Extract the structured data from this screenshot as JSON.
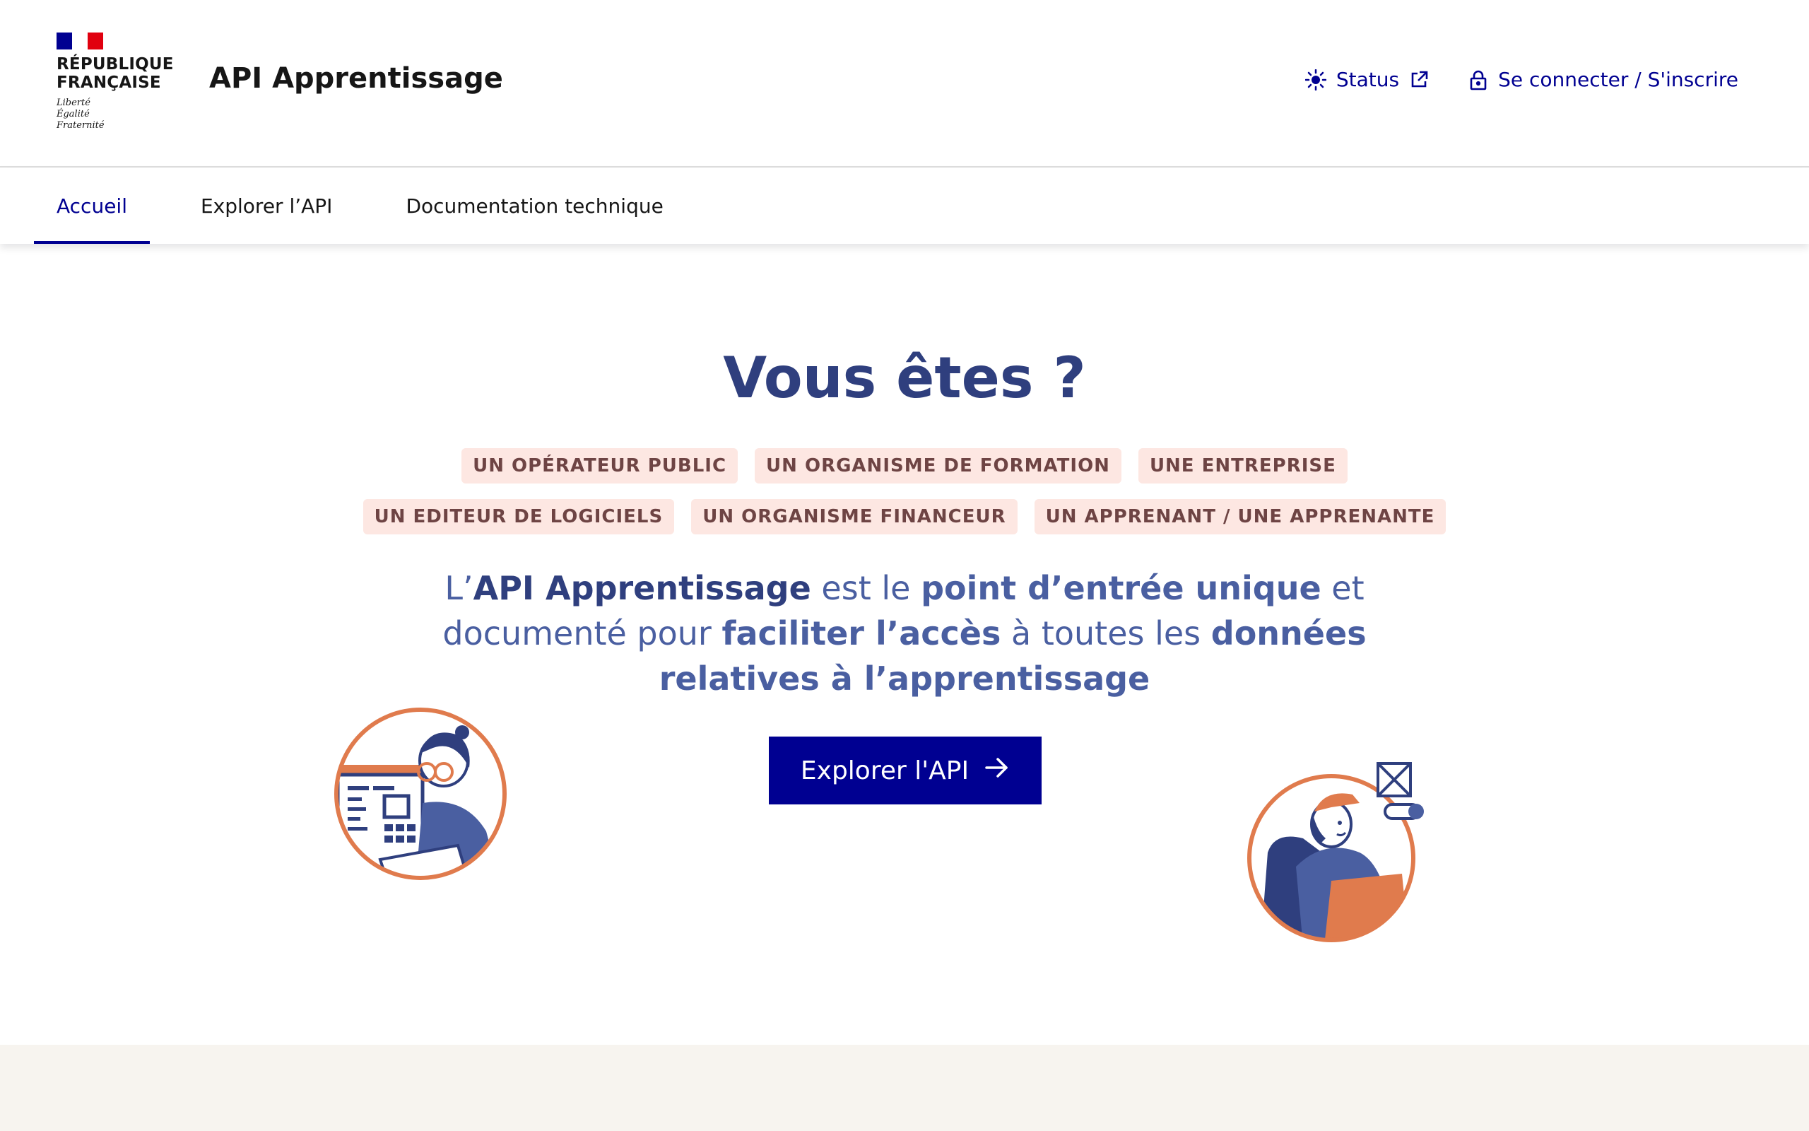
{
  "header": {
    "republique": "RÉPUBLIQUE\nFRANÇAISE",
    "devise": [
      "Liberté",
      "Égalité",
      "Fraternité"
    ],
    "service_title": "API Apprentissage",
    "status_label": "Status",
    "login_label": "Se connecter / S'inscrire"
  },
  "nav": {
    "items": [
      {
        "label": "Accueil",
        "active": true
      },
      {
        "label": "Explorer l’API",
        "active": false
      },
      {
        "label": "Documentation technique",
        "active": false
      }
    ]
  },
  "hero": {
    "title": "Vous êtes ?",
    "tags_row1": [
      "UN OPÉRATEUR PUBLIC",
      "UN ORGANISME DE FORMATION",
      "UNE ENTREPRISE"
    ],
    "tags_row2": [
      "UN EDITEUR DE LOGICIELS",
      "UN ORGANISME FINANCEUR",
      "UN APPRENANT / UNE APPRENANTE"
    ],
    "tagline": {
      "p1": "L’",
      "b1": "API Apprentissage",
      "p2": " est le ",
      "b2": "point d’entrée unique",
      "p3": " et documenté pour ",
      "b3": "faciliter l’accès",
      "p4": " à toutes les ",
      "b4": "données relatives à l’apprentissage"
    },
    "cta_label": "Explorer l'API"
  },
  "colors": {
    "primary": "#000091",
    "title": "#2f3f7e",
    "tag_bg": "#fde7e2",
    "tag_text": "#6e4444",
    "illus_orange": "#e07b4d",
    "illus_blue": "#4a5fa1",
    "footer_bg": "#f7f4ef"
  },
  "icons": [
    "sun-icon",
    "external-link-icon",
    "lock-icon",
    "arrow-right-icon"
  ]
}
